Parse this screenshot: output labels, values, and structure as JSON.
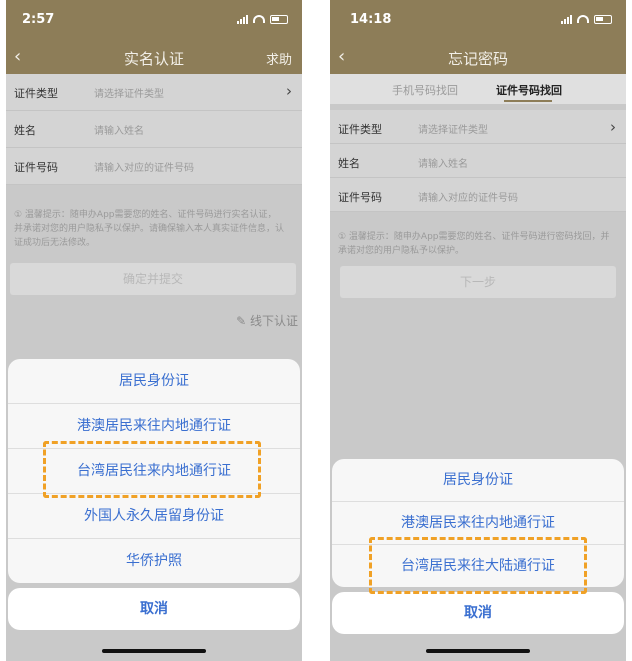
{
  "colors": {
    "header": "#8d7d58",
    "accent_link": "#3a6fd0",
    "highlight": "#f0a126"
  },
  "left": {
    "status_time": "2:57",
    "title": "实名认证",
    "help": "求助",
    "back_icon": "chevron-left-icon",
    "form": [
      {
        "label": "证件类型",
        "placeholder": "请选择证件类型"
      },
      {
        "label": "姓名",
        "placeholder": "请输入姓名"
      },
      {
        "label": "证件号码",
        "placeholder": "请输入对应的证件号码"
      }
    ],
    "tip_line1": "① 温馨提示：随申办App需要您的姓名、证件号码进行实名认证，",
    "tip_line2": "并承诺对您的用户隐私予以保护。请确保输入本人真实证件信息，认",
    "tip_line3": "证成功后无法修改。",
    "submit": "确定并提交",
    "offline": "线下认证",
    "options": [
      "居民身份证",
      "港澳居民来往内地通行证",
      "台湾居民往来内地通行证",
      "外国人永久居留身份证",
      "华侨护照"
    ],
    "cancel": "取消"
  },
  "right": {
    "status_time": "14:18",
    "title": "忘记密码",
    "back_icon": "chevron-left-icon",
    "tabs": [
      "手机号码找回",
      "证件号码找回"
    ],
    "form": [
      {
        "label": "证件类型",
        "placeholder": "请选择证件类型"
      },
      {
        "label": "姓名",
        "placeholder": "请输入姓名"
      },
      {
        "label": "证件号码",
        "placeholder": "请输入对应的证件号码"
      }
    ],
    "tip_line1": "① 温馨提示：随申办App需要您的姓名、证件号码进行密码找回，并",
    "tip_line2": "承诺对您的用户隐私予以保护。",
    "next": "下一步",
    "options": [
      "居民身份证",
      "港澳居民来往内地通行证",
      "台湾居民来往大陆通行证"
    ],
    "cancel": "取消"
  }
}
